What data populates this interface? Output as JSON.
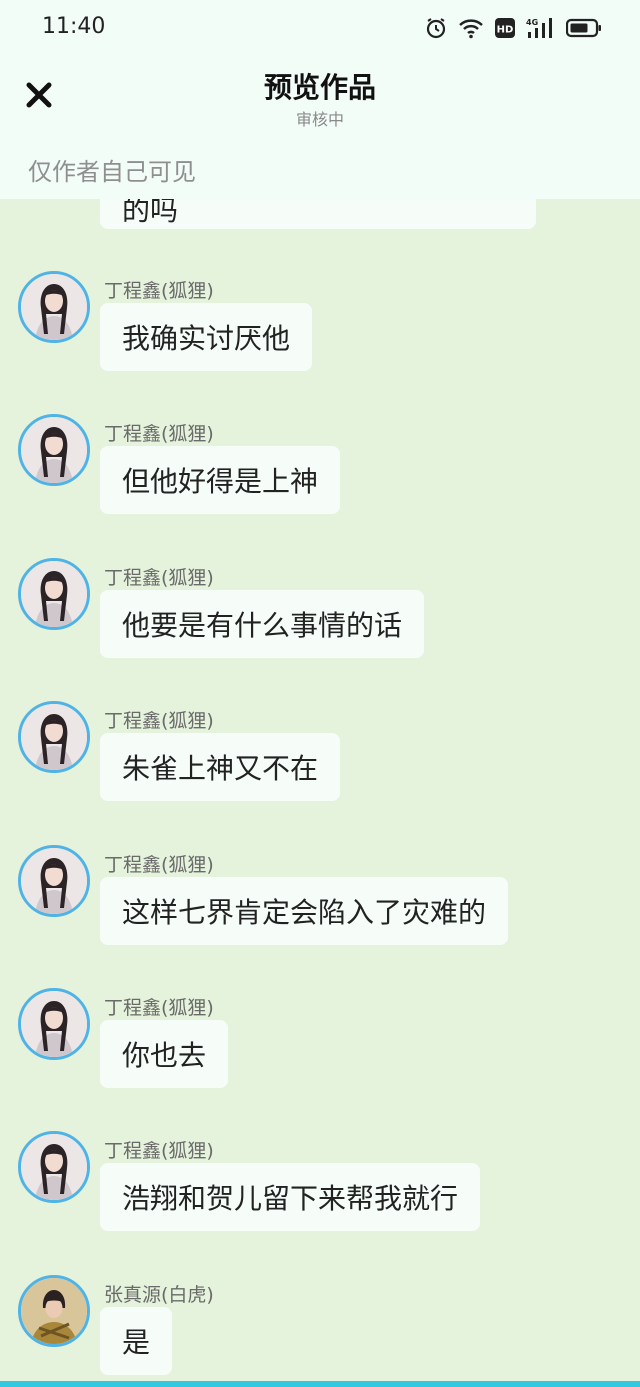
{
  "status_bar": {
    "time": "11:40",
    "icons": [
      "alarm-icon",
      "wifi-icon",
      "hd-icon",
      "signal-4g-icon",
      "battery-icon"
    ],
    "hd_label": "HD",
    "network_label": "4G"
  },
  "header": {
    "title": "预览作品",
    "subtitle": "审核中",
    "close_icon": "close-icon"
  },
  "visibility_note": "仅作者自己可见",
  "partial_message": {
    "text": "的吗"
  },
  "messages": [
    {
      "sender": "丁程鑫(狐狸)",
      "text": "我确实讨厌他",
      "avatar": "dcx"
    },
    {
      "sender": "丁程鑫(狐狸)",
      "text": "但他好得是上神",
      "avatar": "dcx"
    },
    {
      "sender": "丁程鑫(狐狸)",
      "text": "他要是有什么事情的话",
      "avatar": "dcx"
    },
    {
      "sender": "丁程鑫(狐狸)",
      "text": "朱雀上神又不在",
      "avatar": "dcx"
    },
    {
      "sender": "丁程鑫(狐狸)",
      "text": "这样七界肯定会陷入了灾难的",
      "avatar": "dcx"
    },
    {
      "sender": "丁程鑫(狐狸)",
      "text": "你也去",
      "avatar": "dcx"
    },
    {
      "sender": "丁程鑫(狐狸)",
      "text": "浩翔和贺儿留下来帮我就行",
      "avatar": "dcx"
    },
    {
      "sender": "张真源(白虎)",
      "text": "是",
      "avatar": "zzy"
    }
  ],
  "colors": {
    "chat_background": "#e5f3dc",
    "header_background": "#f3fdf8",
    "bubble": "#f6fdf8",
    "avatar_ring": "#4fb3e6",
    "bottom_bar": "#31c9e2"
  }
}
